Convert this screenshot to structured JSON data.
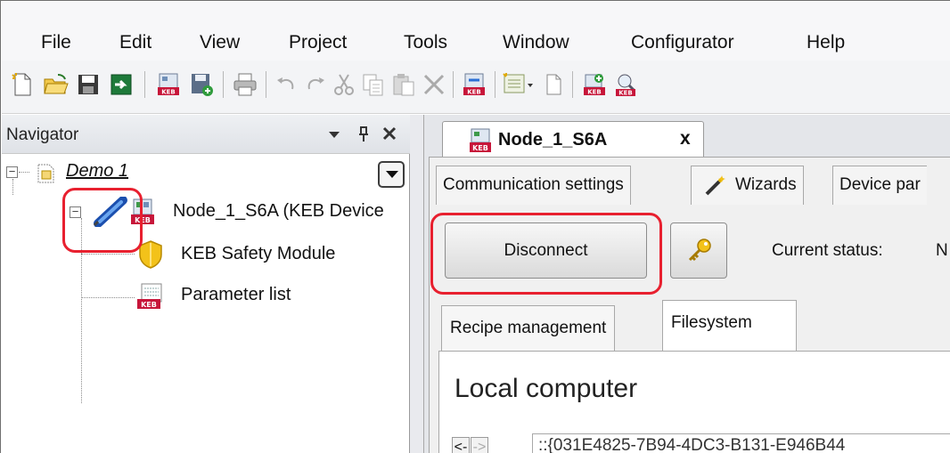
{
  "menu": {
    "items": [
      {
        "label": "File",
        "name": "menu-file"
      },
      {
        "label": "Edit",
        "name": "menu-edit"
      },
      {
        "label": "View",
        "name": "menu-view"
      },
      {
        "label": "Project",
        "name": "menu-project"
      },
      {
        "label": "Tools",
        "name": "menu-tools"
      },
      {
        "label": "Window",
        "name": "menu-window"
      },
      {
        "label": "Configurator",
        "name": "menu-configurator"
      },
      {
        "label": "Help",
        "name": "menu-help"
      }
    ]
  },
  "toolbar": {
    "icons": [
      "new-file-icon",
      "open-folder-icon",
      "save-icon",
      "import-icon",
      "keb-device-icon",
      "keb-save-icon",
      "print-icon",
      "undo-icon",
      "redo-icon",
      "cut-icon",
      "copy-icon",
      "paste-icon",
      "delete-icon",
      "keb-connect-icon",
      "keb-module-dropdown-icon",
      "document-icon",
      "keb-add-icon",
      "keb-search-icon"
    ]
  },
  "navigator": {
    "title": "Navigator",
    "tree": {
      "project": "Demo 1",
      "node": "Node_1_S6A (KEB Device",
      "children": [
        "KEB Safety Module",
        "Parameter list"
      ]
    }
  },
  "document": {
    "tab_label": "Node_1_S6A",
    "close_glyph": "x",
    "subtabs": [
      "Communication settings",
      "Wizards",
      "Device par"
    ],
    "disconnect_label": "Disconnect",
    "status_label": "Current status:",
    "status_value": "N",
    "inner_tabs": [
      "Recipe management",
      "Filesystem"
    ],
    "panel_title": "Local computer",
    "back_glyph": "<-",
    "forward_glyph": "->",
    "path_value": "::{031E4825-7B94-4DC3-B131-E946B44"
  },
  "colors": {
    "highlight": "#e8202f",
    "keb_red": "#c7163a",
    "connect_blue": "#2a6fd6"
  }
}
